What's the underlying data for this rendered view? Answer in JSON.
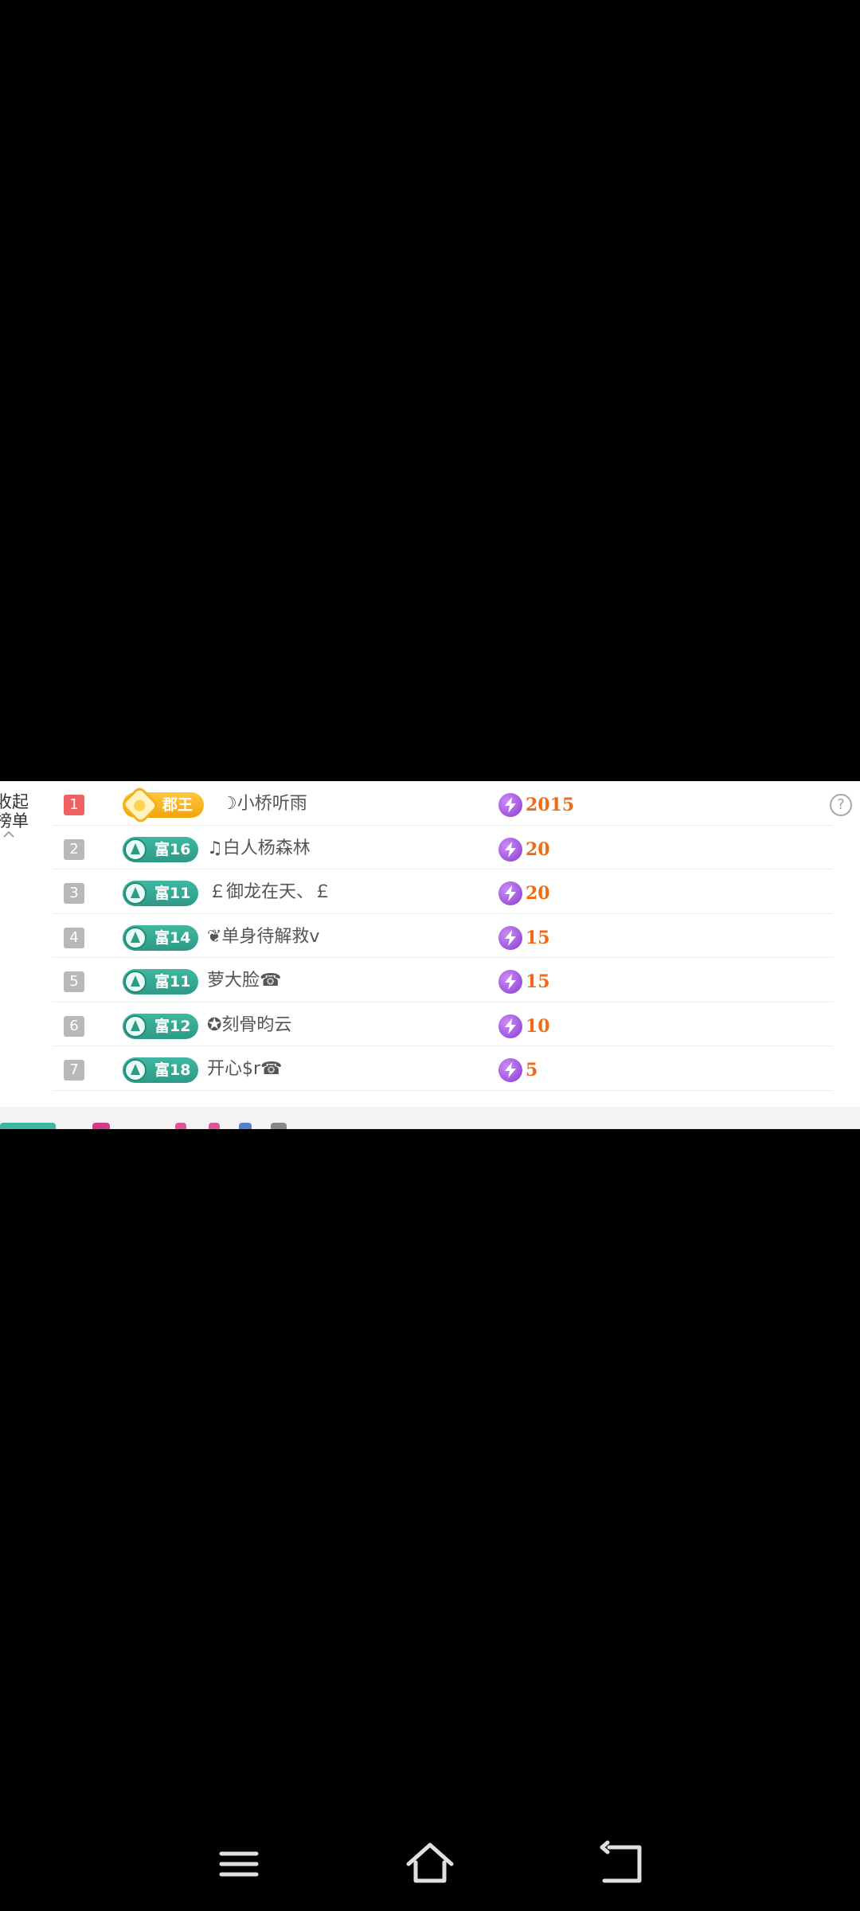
{
  "panel": {
    "collapse_label_1": "收起",
    "collapse_label_2": "榜单",
    "help_symbol": "?"
  },
  "ranking": [
    {
      "rank": "1",
      "badge": "郡王",
      "badge_type": "gold",
      "name": "☽小桥听雨",
      "score": "2015"
    },
    {
      "rank": "2",
      "badge": "富16",
      "badge_type": "green",
      "name": "♫白人杨森林",
      "score": "20"
    },
    {
      "rank": "3",
      "badge": "富11",
      "badge_type": "green",
      "name": "￡御龙在天、￡",
      "score": "20"
    },
    {
      "rank": "4",
      "badge": "富14",
      "badge_type": "green",
      "name": "❦单身待解救v",
      "score": "15"
    },
    {
      "rank": "5",
      "badge": "富11",
      "badge_type": "green",
      "name": "萝大脸☎",
      "score": "15"
    },
    {
      "rank": "6",
      "badge": "富12",
      "badge_type": "green",
      "name": "✪刻骨昀云",
      "score": "10"
    },
    {
      "rank": "7",
      "badge": "富18",
      "badge_type": "green",
      "name": "开心$r☎",
      "score": "5"
    }
  ],
  "colors": {
    "rank_first": "#f06262",
    "rank_other": "#b8b8b8",
    "badge_green": "#2d9a86",
    "badge_gold": "#f0a40c",
    "score_text": "#f06a17",
    "bolt_purple": "#8a3bd1"
  },
  "nav": {
    "menu_icon": "menu-icon",
    "home_icon": "home-icon",
    "back_icon": "back-icon"
  }
}
